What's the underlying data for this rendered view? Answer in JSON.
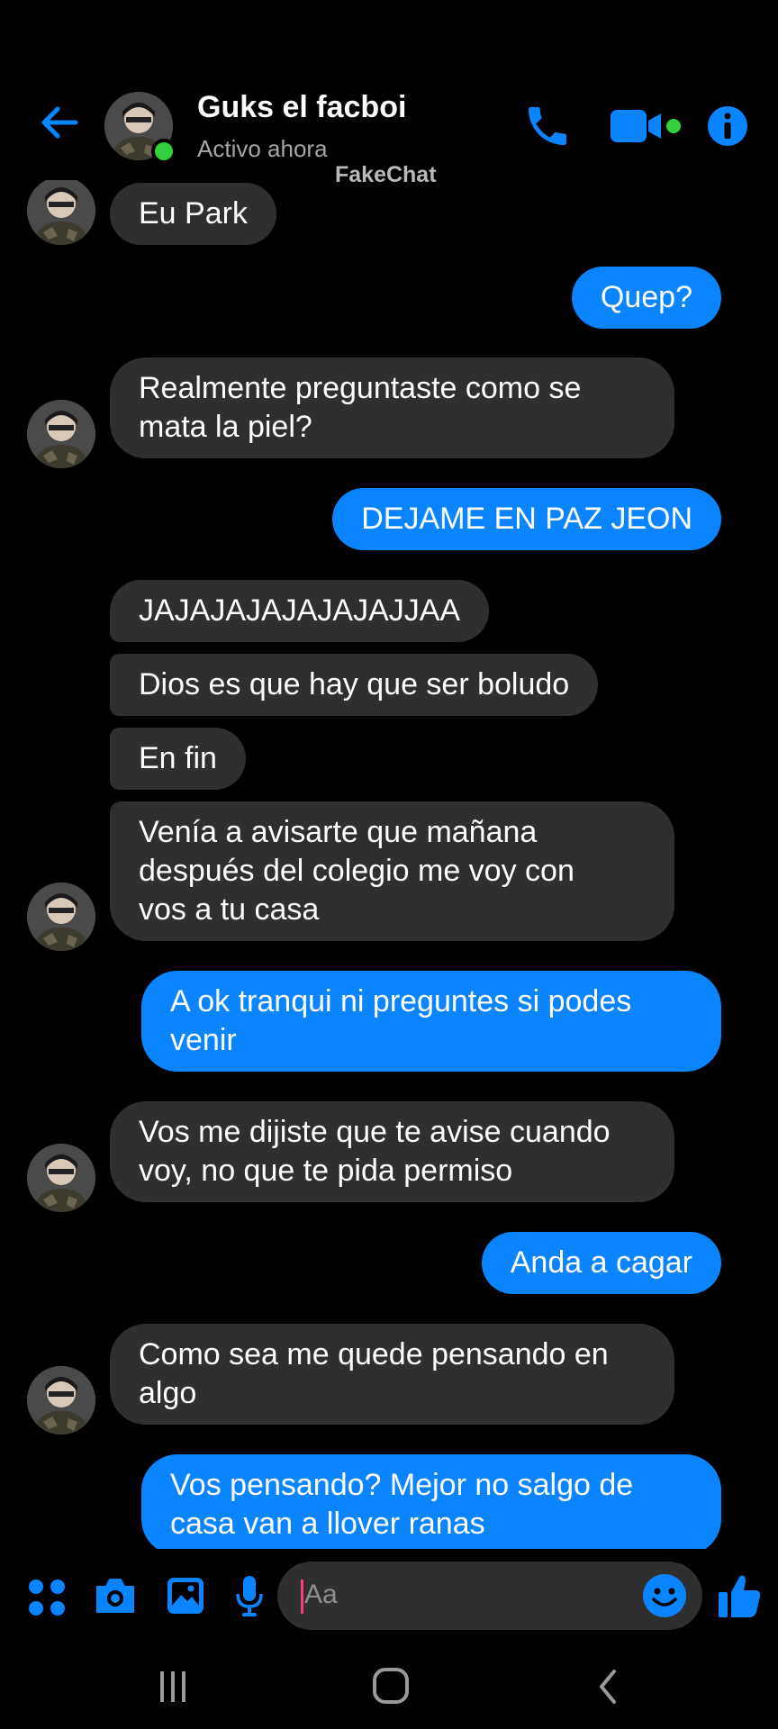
{
  "header": {
    "contact_name": "Guks el facboi",
    "status": "Activo ahora",
    "watermark": "FakeChat"
  },
  "messages": [
    {
      "from": "contact",
      "text": "Eu Park"
    },
    {
      "from": "me",
      "text": "Quep?"
    },
    {
      "from": "contact",
      "lines": [
        "Realmente preguntaste como se",
        "mata la piel?"
      ]
    },
    {
      "from": "me",
      "text": "DEJAME EN PAZ JEON"
    },
    {
      "from": "contact",
      "text": "JAJAJAJAJAJAJAJJAA"
    },
    {
      "from": "contact",
      "text": "Dios es que hay que ser boludo"
    },
    {
      "from": "contact",
      "text": "En fin"
    },
    {
      "from": "contact",
      "lines": [
        "Venía a avisarte que mañana",
        "después del colegio me voy con",
        "vos a tu casa"
      ]
    },
    {
      "from": "me",
      "lines": [
        "A ok tranqui ni preguntes si podes",
        "venir"
      ]
    },
    {
      "from": "contact",
      "lines": [
        "Vos me dijiste que te avise cuando",
        "voy, no que te pida permiso"
      ]
    },
    {
      "from": "me",
      "text": "Anda a cagar"
    },
    {
      "from": "contact",
      "lines": [
        "Como sea me quede pensando en",
        "algo"
      ]
    },
    {
      "from": "me",
      "lines": [
        "Vos pensando? Mejor no salgo de",
        "casa van a llover ranas"
      ]
    }
  ],
  "composer": {
    "placeholder": "Aa"
  },
  "colors": {
    "accent": "#0a84ff",
    "received_bubble": "#2f2f30",
    "online": "#31d03a",
    "background": "#000000"
  },
  "icons": [
    "back-arrow-icon",
    "phone-icon",
    "video-camera-icon",
    "info-icon",
    "apps-grid-icon",
    "camera-icon",
    "gallery-icon",
    "microphone-icon",
    "emoji-icon",
    "thumbs-up-icon",
    "recent-apps-icon",
    "home-icon",
    "back-chevron-icon"
  ]
}
